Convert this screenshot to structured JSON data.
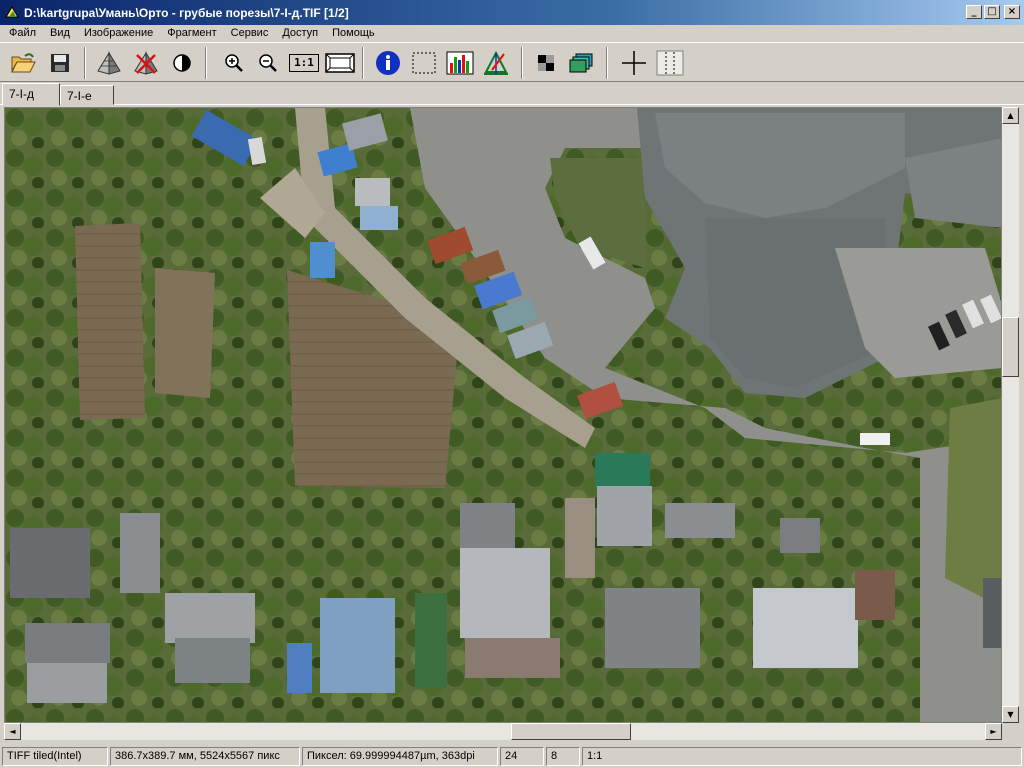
{
  "window": {
    "title": "D:\\kartgrupa\\Умань\\Орто - грубые порезы\\7-I-д.TIF  [1/2]",
    "buttons": {
      "minimize": "_",
      "maximize": "□",
      "close": "×"
    }
  },
  "menu": [
    "Файл",
    "Вид",
    "Изображение",
    "Фрагмент",
    "Сервис",
    "Доступ",
    "Помощь"
  ],
  "toolbar": [
    {
      "name": "open-folder-icon"
    },
    {
      "name": "save-disk-icon"
    },
    {
      "name": "pyramid-icon"
    },
    {
      "name": "pyramid-delete-icon"
    },
    {
      "name": "contrast-icon"
    },
    {
      "name": "zoom-in-icon"
    },
    {
      "name": "zoom-out-icon"
    },
    {
      "name": "actual-size-icon",
      "label": "1:1"
    },
    {
      "name": "fit-window-icon"
    },
    {
      "name": "info-icon"
    },
    {
      "name": "select-rectangle-icon"
    },
    {
      "name": "histogram-icon"
    },
    {
      "name": "color-balance-icon"
    },
    {
      "name": "checkerboard-icon"
    },
    {
      "name": "layers-icon"
    },
    {
      "name": "crosshair-icon"
    },
    {
      "name": "grid-lines-icon"
    }
  ],
  "tabs": [
    {
      "label": "7-I-д",
      "active": true
    },
    {
      "label": "7-I-е",
      "active": false
    }
  ],
  "scrollbars": {
    "vertical_position": 0.37,
    "horizontal_position": 0.58,
    "up": "▲",
    "down": "▼",
    "left": "◄",
    "right": "►"
  },
  "status": {
    "format": "TIFF tiled(Intel)",
    "size": "386.7x389.7 мм, 5524x5567 пикс",
    "pixel": "Пиксел:  69.999994487µm, 363dpi",
    "bits": "24",
    "channels": "8",
    "zoom": "1:1"
  },
  "colors": {
    "title_start": "#0a246a",
    "title_end": "#a6caf0",
    "chrome": "#d4d0c8"
  }
}
